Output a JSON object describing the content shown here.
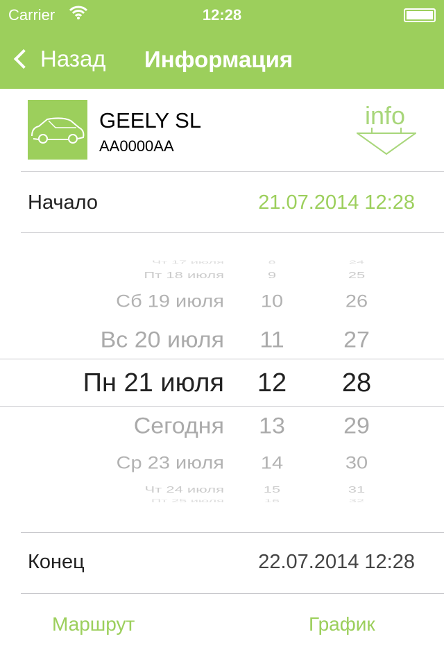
{
  "status_bar": {
    "carrier": "Carrier",
    "time": "12:28",
    "wifi_icon": "wifi-icon",
    "battery_level": 1.0
  },
  "nav": {
    "back_label": "Назад",
    "title": "Информация"
  },
  "car": {
    "name": "GEELY SL",
    "plate": "AA0000AA",
    "info_label": "info"
  },
  "start": {
    "label": "Начало",
    "value": "21.07.2014 12:28"
  },
  "picker": {
    "rows": [
      {
        "day": "Чт 17 июля",
        "hour": "8",
        "minute": "24"
      },
      {
        "day": "Пт 18 июля",
        "hour": "9",
        "minute": "25"
      },
      {
        "day": "Сб 19 июля",
        "hour": "10",
        "minute": "26"
      },
      {
        "day": "Вс 20 июля",
        "hour": "11",
        "minute": "27"
      },
      {
        "day": "Пн 21 июля",
        "hour": "12",
        "minute": "28"
      },
      {
        "day": "Сегодня",
        "hour": "13",
        "minute": "29"
      },
      {
        "day": "Ср 23 июля",
        "hour": "14",
        "minute": "30"
      },
      {
        "day": "Чт 24 июля",
        "hour": "15",
        "minute": "31"
      },
      {
        "day": "Пт 25 июля",
        "hour": "16",
        "minute": "32"
      }
    ],
    "selected_index": 4
  },
  "end": {
    "label": "Конец",
    "value": "22.07.2014 12:28"
  },
  "bottom": {
    "route_label": "Маршрут",
    "schedule_label": "График"
  },
  "colors": {
    "accent": "#9ccf5c",
    "text": "#222222",
    "muted": "#aaaaaa"
  }
}
